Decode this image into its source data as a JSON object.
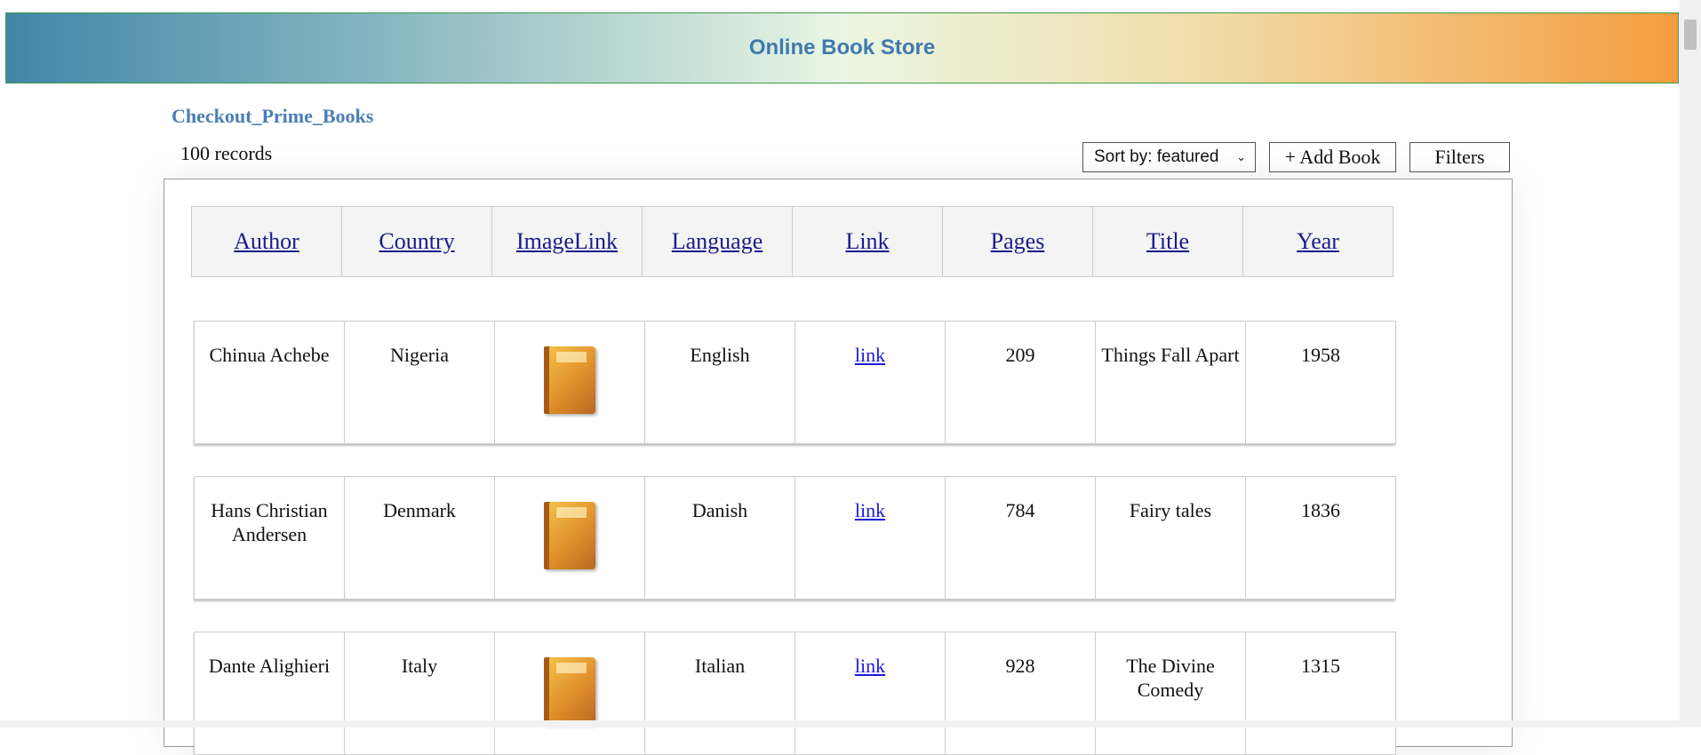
{
  "header": {
    "title": "Online Book Store"
  },
  "store_link": "Checkout_Prime_Books",
  "record_count": "100 records",
  "toolbar": {
    "sort_label": "Sort by: featured",
    "add_label": "+ Add Book",
    "filters_label": "Filters"
  },
  "table": {
    "headers": [
      "Author",
      "Country",
      "ImageLink",
      "Language",
      "Link",
      "Pages",
      "Title",
      "Year"
    ],
    "rows": [
      {
        "author": "Chinua Achebe",
        "country": "Nigeria",
        "image": "book-cover",
        "language": "English",
        "link": "link",
        "pages": "209",
        "title": "Things Fall Apart",
        "year": "1958"
      },
      {
        "author": "Hans Christian Andersen",
        "country": "Denmark",
        "image": "book-cover",
        "language": "Danish",
        "link": "link",
        "pages": "784",
        "title": "Fairy tales",
        "year": "1836"
      },
      {
        "author": "Dante Alighieri",
        "country": "Italy",
        "image": "book-cover",
        "language": "Italian",
        "link": "link",
        "pages": "928",
        "title": "The Divine Comedy",
        "year": "1315"
      }
    ]
  },
  "colors": {
    "accent": "#4a7db4",
    "header_gradient_start": "#4186a8",
    "header_gradient_end": "#f59d3e"
  }
}
